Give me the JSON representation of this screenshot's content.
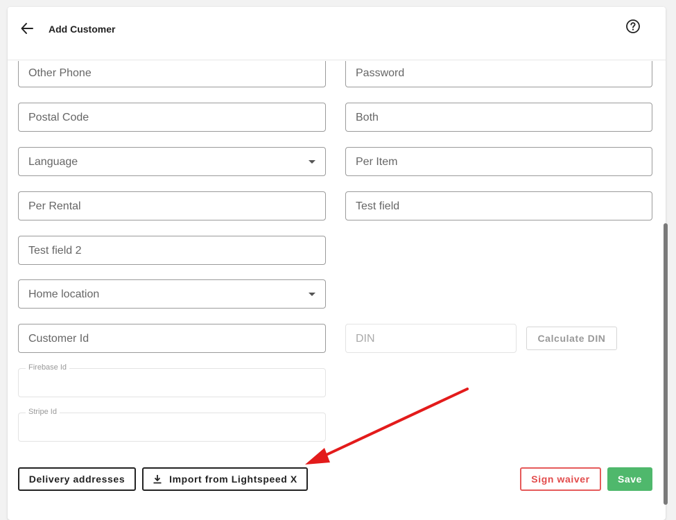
{
  "header": {
    "title": "Add Customer",
    "back_icon": "arrow-left-icon",
    "help_icon": "help-circle-icon"
  },
  "fields": {
    "other_phone": "Other Phone",
    "password": "Password",
    "postal_code": "Postal Code",
    "both": "Both",
    "language": "Language",
    "per_item": "Per Item",
    "per_rental": "Per Rental",
    "test_field": "Test field",
    "test_field_2": "Test field 2",
    "home_location": "Home location",
    "customer_id": "Customer Id",
    "din": "DIN",
    "firebase_id": "Firebase Id",
    "stripe_id": "Stripe Id"
  },
  "buttons": {
    "calculate_din": "Calculate DIN",
    "delivery_addresses": "Delivery addresses",
    "import_lightspeed": "Import from Lightspeed X",
    "sign_waiver": "Sign waiver",
    "save": "Save"
  },
  "colors": {
    "save": "#4fb86c",
    "sign_waiver": "#e24b4b",
    "annotation_arrow": "#e31b1b"
  }
}
